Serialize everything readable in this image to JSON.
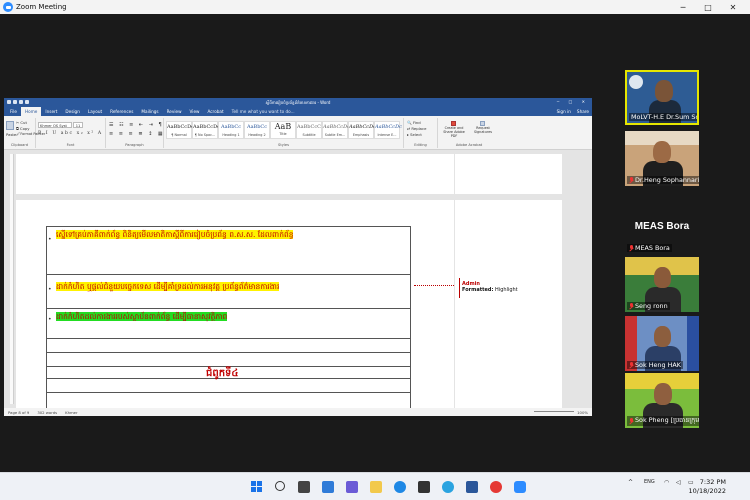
{
  "zoom": {
    "window_title": "Zoom Meeting",
    "controls": {
      "minimize": "─",
      "maximize": "□",
      "close": "✕"
    }
  },
  "word": {
    "doc_title": "ស្ដីពីការរៀបចំប្រព័ន្ធព័ត៌មានការងារ - Word",
    "tabs": [
      "File",
      "Home",
      "Insert",
      "Design",
      "Layout",
      "References",
      "Mailings",
      "Review",
      "View",
      "Acrobat"
    ],
    "active_tab": "Home",
    "tell_me": "Tell me what you want to do...",
    "sign_in": "Sign in",
    "share": "Share",
    "clipboard": {
      "paste": "Paste",
      "cut": "Cut",
      "copy": "Copy",
      "format_painter": "Format Painter",
      "group": "Clipboard"
    },
    "font": {
      "name": "Khmer OS Syst",
      "size": "11",
      "group": "Font",
      "format_row": "B I U abc x₂ x² A"
    },
    "paragraph_group": "Paragraph",
    "styles": [
      {
        "preview": "AaBbCcDc",
        "name": "¶ Normal"
      },
      {
        "preview": "AaBbCcDc",
        "name": "¶ No Spac..."
      },
      {
        "preview": "AaBbCc",
        "name": "Heading 1"
      },
      {
        "preview": "AaBbCc",
        "name": "Heading 2"
      },
      {
        "preview": "AaB",
        "name": "Title"
      },
      {
        "preview": "AaBbCcC",
        "name": "Subtitle"
      },
      {
        "preview": "AaBbCcDc",
        "name": "Subtle Em..."
      },
      {
        "preview": "AaBbCcDc",
        "name": "Emphasis"
      },
      {
        "preview": "AaBbCcDc",
        "name": "Intense E..."
      }
    ],
    "styles_group": "Styles",
    "editing": {
      "find": "Find",
      "replace": "Replace",
      "select": "Select",
      "group": "Editing"
    },
    "acrobat": {
      "create": "Create and Share Adobe PDF",
      "request": "Request Signatures",
      "group": "Adobe Acrobat"
    },
    "paragraphs": [
      "ស្នើទៅគ្រប់ភាគីពាក់ព័ន្ធ ពិនិត្យមើលមាតិកាស្ដីពីការរៀបចំប្រព័ន្ធ ព.ស.ស. ដែលពាក់ព័ន្ធ",
      "ដាក់កំហិត ឬផ្ដល់ជំនួយបច្ចេកទេស ដើម្បីគាំទ្រដល់ការអនុវត្ត ប្រព័ន្ធព័ត៌មានការងារ",
      "ដាក់កំហិតដល់ការងាររបស់ស្ថាប័នពាក់ព័ន្ធ ដើម្បីធានាសុវត្ថិភាព"
    ],
    "chapter_heading": "ជំពូកទី៤",
    "comment": {
      "author": "Admin",
      "label": "Formatted:",
      "value": "Highlight"
    },
    "status": {
      "page": "Page 8 of 9",
      "words": "302 words",
      "language": "Khmer",
      "zoom": "100%"
    }
  },
  "participants": [
    {
      "name": "MoLVT-H.E Dr.Sum Sophorn",
      "muted": false,
      "active": true
    },
    {
      "name": "Dr.Heng Sophannarith",
      "muted": true,
      "active": false
    },
    {
      "name": "MEAS Bora",
      "muted": true,
      "active": false,
      "display_text": "MEAS Bora"
    },
    {
      "name": "Seng ronn",
      "muted": true,
      "active": false
    },
    {
      "name": "Sok Heng HAK",
      "muted": true,
      "active": false
    },
    {
      "name": "Sok Pheng [ប្រធានក្រុម]",
      "muted": true,
      "active": false
    }
  ],
  "taskbar": {
    "clock_time": "7:32 PM",
    "clock_date": "10/18/2022"
  }
}
